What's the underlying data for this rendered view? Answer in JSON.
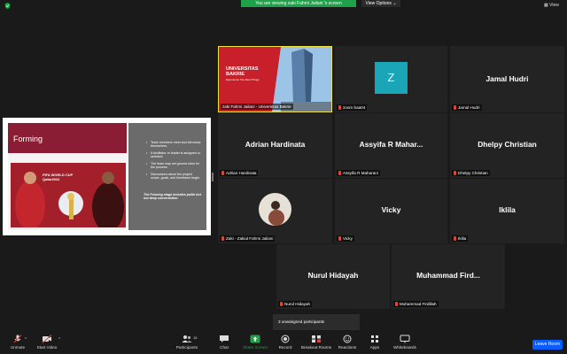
{
  "top_bar": {
    "banner_text": "You are viewing zaki Fahmi Jailani 's screen",
    "view_options_label": "View Options ⌄",
    "view_label": "View"
  },
  "shared_slide": {
    "title": "Forming",
    "photo_caption": "FIFA WORLD CUP Qatar2022",
    "bullets": [
      "Team members meet and introduce themselves.",
      "A facilitator or leader is assigned or selected.",
      "The team may set ground rules for the process.",
      "Discussions about the project scope, goals, and timeframe begin."
    ],
    "note": "The Forming stage includes polite but not deep conversation."
  },
  "featured_tile": {
    "title": "UNIVERSITAS BAKRIE",
    "subtitle": "Experience The Best Things",
    "label": "zaki Fahmi Jailani - Universitas Bakrie"
  },
  "tiles": [
    {
      "avatar_letter": "Z",
      "label": "zoom baa04"
    },
    {
      "name": "Jamal Hudri",
      "label": "Jamal Hudri"
    },
    {
      "name": "Adrian Hardinata",
      "label": "Adrian Hardinata"
    },
    {
      "name": "Assyifa R Mahar...",
      "label": "Assyifa R Maharani"
    },
    {
      "name": "Dhelpy Christian",
      "label": "Dhelpy Christian"
    },
    {
      "label": "Zaki - Zakiul Fahmi Jailani"
    },
    {
      "name": "Vicky",
      "label": "Vicky"
    },
    {
      "name": "Iklila",
      "label": "Iklila"
    },
    {
      "name": "Nurul Hidayah",
      "label": "Nurul Hidayah"
    },
    {
      "name": "Muhammad Fird...",
      "label": "Muhammad Firdillah"
    }
  ],
  "unassigned": "3 unassigned participants",
  "toolbar": {
    "unmute": "Unmute",
    "start_video": "Start Video",
    "participants": "Participants",
    "participants_count": "15",
    "chat": "Chat",
    "share_screen": "Share Screen",
    "record": "Record",
    "breakout_rooms": "Breakout Rooms",
    "reactions": "Reactions",
    "apps": "Apps",
    "whiteboards": "Whiteboards",
    "leave_room": "Leave Room"
  },
  "colors": {
    "banner_green": "#1fa14a",
    "leave_blue": "#0b5cff",
    "active_speaker": "#f0e040",
    "slide_maroon": "#8a1d34",
    "avatar_teal": "#1aa6b7"
  }
}
